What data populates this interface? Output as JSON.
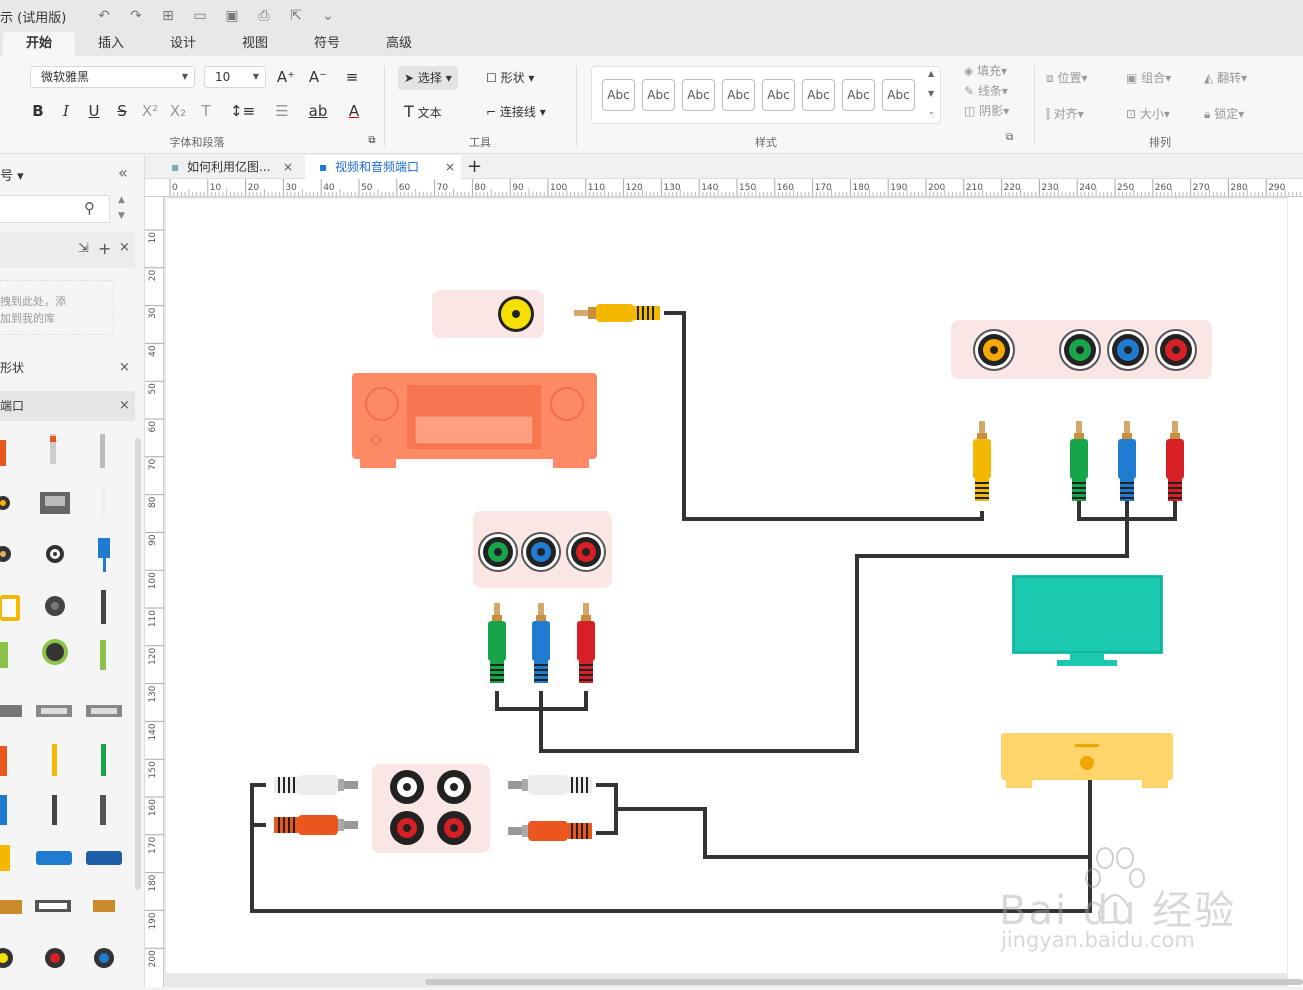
{
  "titlebar": {
    "title": "示 (试用版)"
  },
  "menu_tabs": [
    "开始",
    "插入",
    "设计",
    "视图",
    "符号",
    "高级"
  ],
  "ribbon": {
    "font_name": "微软雅黑",
    "font_size": "10",
    "font_group_label": "字体和段落",
    "select_label": "选择",
    "shape_label": "形状",
    "text_label": "文本",
    "connector_label": "连接线",
    "tools_group_label": "工具",
    "style_sample": "Abc",
    "styles_group_label": "样式",
    "fill_label": "填充",
    "line_label": "线条",
    "shadow_label": "阴影",
    "position_label": "位置",
    "group_label": "组合",
    "flip_label": "翻转",
    "align_label": "对齐",
    "size_label": "大小",
    "lock_label": "锁定",
    "arrange_group_label": "排列"
  },
  "left_panel": {
    "header": "号",
    "drop_hint_1": "拽到此处，添",
    "drop_hint_2": "加到我的库",
    "section_shapes": "形状",
    "section_ports": "端口"
  },
  "doc_tabs": [
    {
      "label": "如何利用亿图..."
    },
    {
      "label": "视频和音频端口"
    }
  ],
  "ruler_top_ticks": [
    "0",
    "10",
    "20",
    "30",
    "40",
    "50",
    "60",
    "70",
    "80",
    "90",
    "100",
    "110",
    "120",
    "130",
    "140",
    "150",
    "160",
    "170",
    "180",
    "190",
    "200",
    "210",
    "220",
    "230",
    "240",
    "250",
    "260",
    "270",
    "280",
    "290"
  ],
  "ruler_left_ticks": [
    "10",
    "20",
    "30",
    "40",
    "50",
    "60",
    "70",
    "80",
    "90",
    "100",
    "110",
    "120",
    "130",
    "140",
    "150",
    "160",
    "170",
    "180",
    "190",
    "200"
  ],
  "watermark": {
    "brand": "Bai du 经验",
    "url": "jingyan.baidu.com"
  },
  "colors": {
    "receiver": "#FF8A65",
    "tv": "#1BC8B0",
    "player": "#FFD56B",
    "panel_bg": "#F9E6E5",
    "cable": "#333333",
    "yellow": "#F5B800",
    "green": "#17A54A",
    "blue": "#1E7BD0",
    "red": "#D71F26",
    "white": "#EDEDED",
    "orange": "#E9561E"
  }
}
